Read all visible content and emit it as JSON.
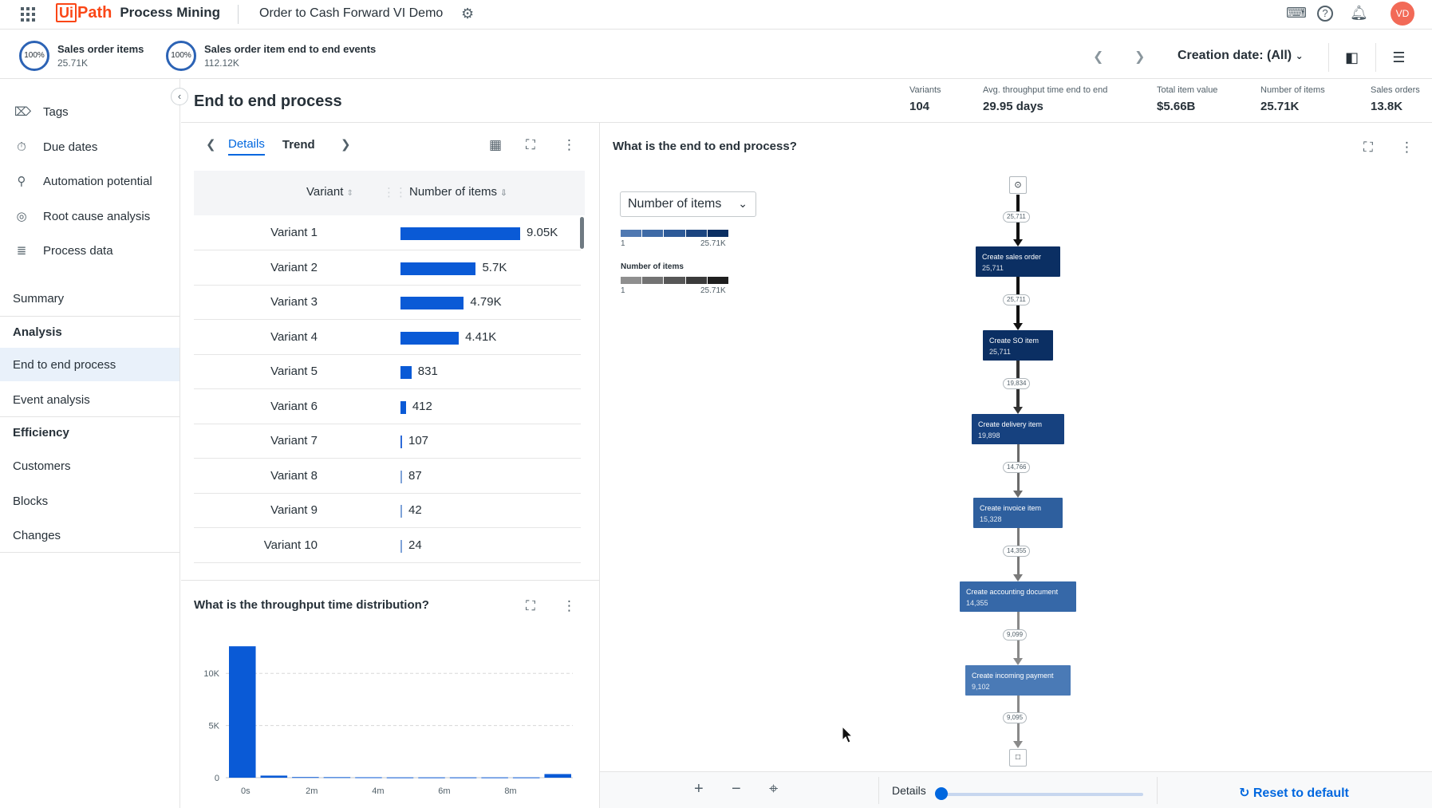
{
  "topbar": {
    "brand_ui": "Ui",
    "brand_path": "Path",
    "product": "Process Mining",
    "app_title": "Order to Cash Forward VI Demo",
    "user_initials": "VD"
  },
  "subbar": {
    "kpis": [
      {
        "percent": "100%",
        "label": "Sales order items",
        "value": "25.71K"
      },
      {
        "percent": "100%",
        "label": "Sales order item end to end events",
        "value": "112.12K"
      }
    ],
    "creation_date": "Creation date: (All)"
  },
  "sidebar": {
    "tools": [
      {
        "label": "Tags",
        "icon": "tag-icon"
      },
      {
        "label": "Due dates",
        "icon": "timer-icon"
      },
      {
        "label": "Automation potential",
        "icon": "robot-icon"
      },
      {
        "label": "Root cause analysis",
        "icon": "target-icon"
      },
      {
        "label": "Process data",
        "icon": "list-icon"
      }
    ],
    "summary": "Summary",
    "analysis_heading": "Analysis",
    "analysis_items": [
      "End to end process",
      "Event analysis"
    ],
    "efficiency_heading": "Efficiency",
    "efficiency_items": [
      "Customers",
      "Blocks",
      "Changes"
    ]
  },
  "page": {
    "title": "End to end process",
    "metrics": [
      {
        "label": "Variants",
        "value": "104"
      },
      {
        "label": "Avg. throughput time end to end",
        "value": "29.95 days"
      },
      {
        "label": "Total item value",
        "value": "$5.66B"
      },
      {
        "label": "Number of items",
        "value": "25.71K"
      },
      {
        "label": "Sales orders",
        "value": "13.8K"
      }
    ]
  },
  "variants_panel": {
    "tabs": [
      "Details",
      "Trend"
    ],
    "columns": [
      "Variant",
      "Number of items"
    ],
    "rows": [
      {
        "name": "Variant 1",
        "value": 9050,
        "label": "9.05K"
      },
      {
        "name": "Variant 2",
        "value": 5700,
        "label": "5.7K"
      },
      {
        "name": "Variant 3",
        "value": 4790,
        "label": "4.79K"
      },
      {
        "name": "Variant 4",
        "value": 4410,
        "label": "4.41K"
      },
      {
        "name": "Variant 5",
        "value": 831,
        "label": "831"
      },
      {
        "name": "Variant 6",
        "value": 412,
        "label": "412"
      },
      {
        "name": "Variant 7",
        "value": 107,
        "label": "107"
      },
      {
        "name": "Variant 8",
        "value": 87,
        "label": "87"
      },
      {
        "name": "Variant 9",
        "value": 42,
        "label": "42"
      },
      {
        "name": "Variant 10",
        "value": 24,
        "label": "24"
      }
    ]
  },
  "throughput_panel": {
    "title": "What is the throughput time distribution?"
  },
  "chart_data": {
    "type": "bar",
    "x": [
      "0s",
      "",
      "",
      "",
      "",
      "",
      "",
      "",
      "",
      "",
      ""
    ],
    "x_ticks": [
      "0s",
      "2m",
      "4m",
      "6m",
      "8m"
    ],
    "values": [
      12600,
      200,
      60,
      50,
      40,
      30,
      30,
      30,
      30,
      30,
      350
    ],
    "y_ticks": [
      "0",
      "5K",
      "10K"
    ],
    "ylim": [
      0,
      13000
    ],
    "grid": true,
    "color": "#0a5ad6"
  },
  "process_panel": {
    "title": "What is the end to end process?",
    "metric_dropdown": "Number of items",
    "legend_min": "1",
    "legend_max": "25.71K",
    "legend_label": "Number of items",
    "start_icon": "start-node-icon",
    "end_icon": "end-node-icon",
    "nodes": [
      {
        "label": "Create sales order",
        "value": "25,711",
        "color": "#0b2f63"
      },
      {
        "label": "Create SO item",
        "value": "25,711",
        "color": "#0b2f63"
      },
      {
        "label": "Create delivery item",
        "value": "19,898",
        "color": "#16417f"
      },
      {
        "label": "Create invoice item",
        "value": "15,328",
        "color": "#2e5f9e"
      },
      {
        "label": "Create accounting document",
        "value": "14,355",
        "color": "#3668a8"
      },
      {
        "label": "Create incoming payment",
        "value": "9,102",
        "color": "#4a7ab6"
      }
    ],
    "edges": [
      "25,711",
      "25,711",
      "19,834",
      "14,766",
      "14,355",
      "9,099",
      "9,095"
    ],
    "details_label": "Details",
    "reset_label": "Reset to default"
  }
}
